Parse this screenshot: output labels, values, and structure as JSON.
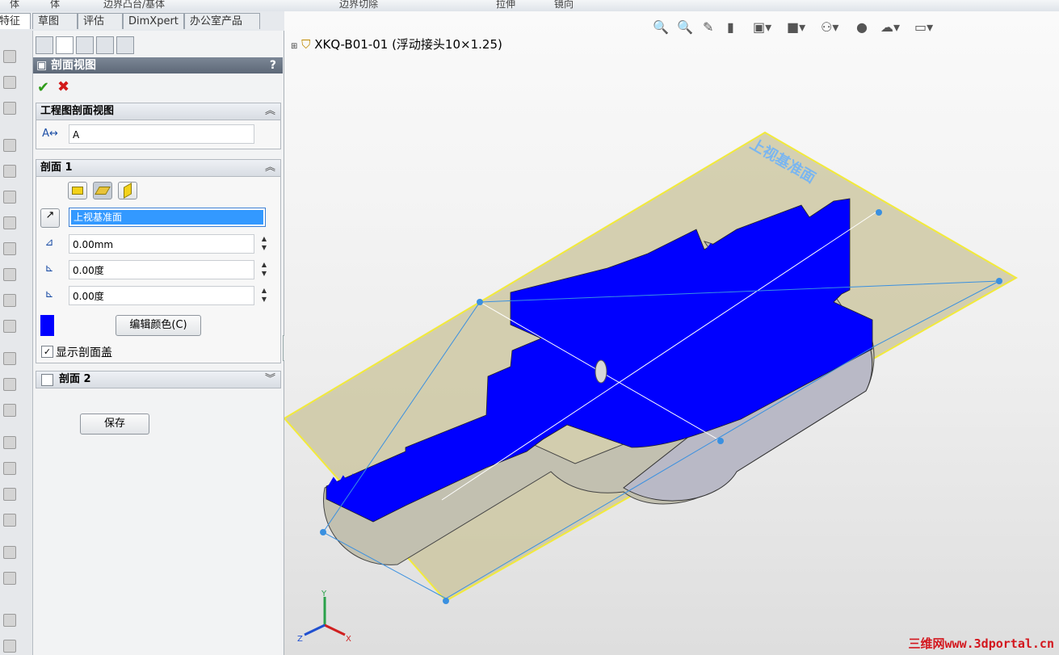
{
  "top_strip": {
    "items": [
      "体",
      "体",
      "边界凸台/基体",
      "边界切除",
      "拉伸",
      "镜向"
    ]
  },
  "command_tabs": [
    "特征",
    "草图",
    "评估",
    "DimXpert",
    "办公室产品"
  ],
  "property_manager": {
    "title": "剖面视图",
    "help": "?",
    "ok": "✔",
    "cancel": "✖",
    "group1": {
      "title": "工程图剖面视图",
      "label_value": "A"
    },
    "group2": {
      "title": "剖面 1",
      "reference_plane": "上视基准面",
      "offset": "0.00mm",
      "angle_x": "0.00度",
      "angle_y": "0.00度",
      "edit_color_button": "编辑颜色(C)",
      "show_cap_checkbox": "显示剖面盖",
      "show_cap_checked": true,
      "cap_color": "#0000ff"
    },
    "group3": {
      "title": "剖面 2",
      "checked": false
    },
    "save_button": "保存"
  },
  "viewport": {
    "tree_item": "XKQ-B01-01 (浮动接头10×1.25)",
    "plane_label": "上视基准面",
    "triad": {
      "y": "Y",
      "z": "Z",
      "x": "X"
    },
    "watermark": "三维网www.3dportal.cn",
    "colors": {
      "section_cap": "#0000ff",
      "plane_fill": "#c9c39a",
      "plane_border": "#f2ea3a",
      "part_metal": "#c2c0b0"
    }
  }
}
